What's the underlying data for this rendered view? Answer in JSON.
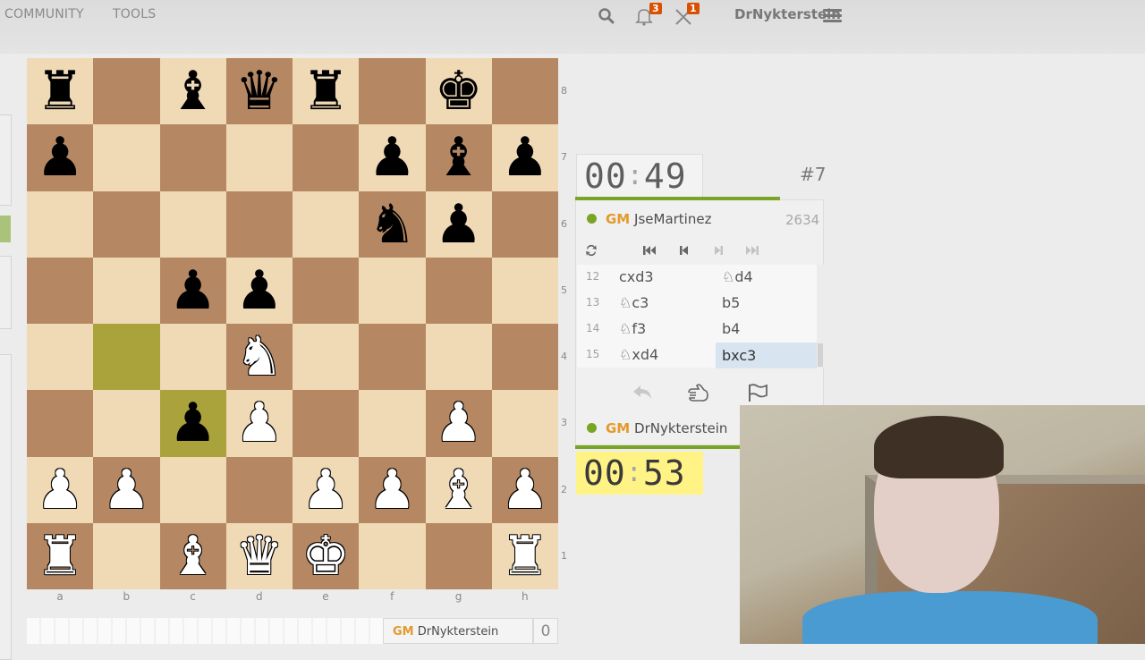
{
  "topbar": {
    "nav": [
      "COMMUNITY",
      "TOOLS"
    ],
    "icons": [
      "search-icon",
      "bell-icon",
      "crossed-swords-icon",
      "hamburger-menu-icon"
    ],
    "notifications_count": "3",
    "challenges_count": "1",
    "username": "DrNykterstein"
  },
  "board": {
    "files": [
      "a",
      "b",
      "c",
      "d",
      "e",
      "f",
      "g",
      "h"
    ],
    "ranks": [
      "8",
      "7",
      "6",
      "5",
      "4",
      "3",
      "2",
      "1"
    ],
    "position": [
      [
        "bR",
        "",
        "bB",
        "bQ",
        "bR",
        "",
        "bK",
        ""
      ],
      [
        "bP",
        "",
        "",
        "",
        "",
        "bP",
        "bB",
        "bP"
      ],
      [
        "",
        "",
        "",
        "",
        "",
        "bN",
        "bP",
        ""
      ],
      [
        "",
        "",
        "bP",
        "bP",
        "",
        "",
        "",
        ""
      ],
      [
        "",
        "",
        "",
        "wN",
        "",
        "",
        "",
        ""
      ],
      [
        "",
        "",
        "bP",
        "wP",
        "",
        "",
        "wP",
        ""
      ],
      [
        "wP",
        "wP",
        "",
        "",
        "wP",
        "wP",
        "wB",
        "wP"
      ],
      [
        "wR",
        "",
        "wB",
        "wQ",
        "wK",
        "",
        "",
        "wR"
      ]
    ],
    "highlighted_squares": [
      "b4",
      "c3"
    ],
    "colors": {
      "light": "#f0d9b5",
      "dark": "#b58863",
      "highlight": "#aaa23a"
    }
  },
  "game": {
    "number": "#7",
    "top_clock": {
      "min": "00",
      "sec": "49"
    },
    "bottom_clock": {
      "min": "00",
      "sec": "53"
    },
    "top_player": {
      "title": "GM",
      "name": "JseMartinez",
      "rating": "2634"
    },
    "bottom_player": {
      "title": "GM",
      "name": "DrNykterstein"
    },
    "moves": [
      {
        "num": "12",
        "white": "cxd3",
        "black": "♘d4"
      },
      {
        "num": "13",
        "white": "♘c3",
        "black": "b5"
      },
      {
        "num": "14",
        "white": "♘f3",
        "black": "b4"
      },
      {
        "num": "15",
        "white": "♘xd4",
        "black": "bxc3"
      }
    ],
    "active_move": "bxc3",
    "controls": [
      "flip-board-icon",
      "first-move-icon",
      "prev-move-icon",
      "next-move-icon",
      "last-move-icon"
    ],
    "actions": [
      "takeback-icon",
      "draw-offer-icon",
      "resign-flag-icon"
    ]
  },
  "bottom_bar": {
    "title": "GM",
    "name": "DrNykterstein",
    "score": "0"
  },
  "accent": "#7aa425",
  "title_color": "#e39a2d"
}
